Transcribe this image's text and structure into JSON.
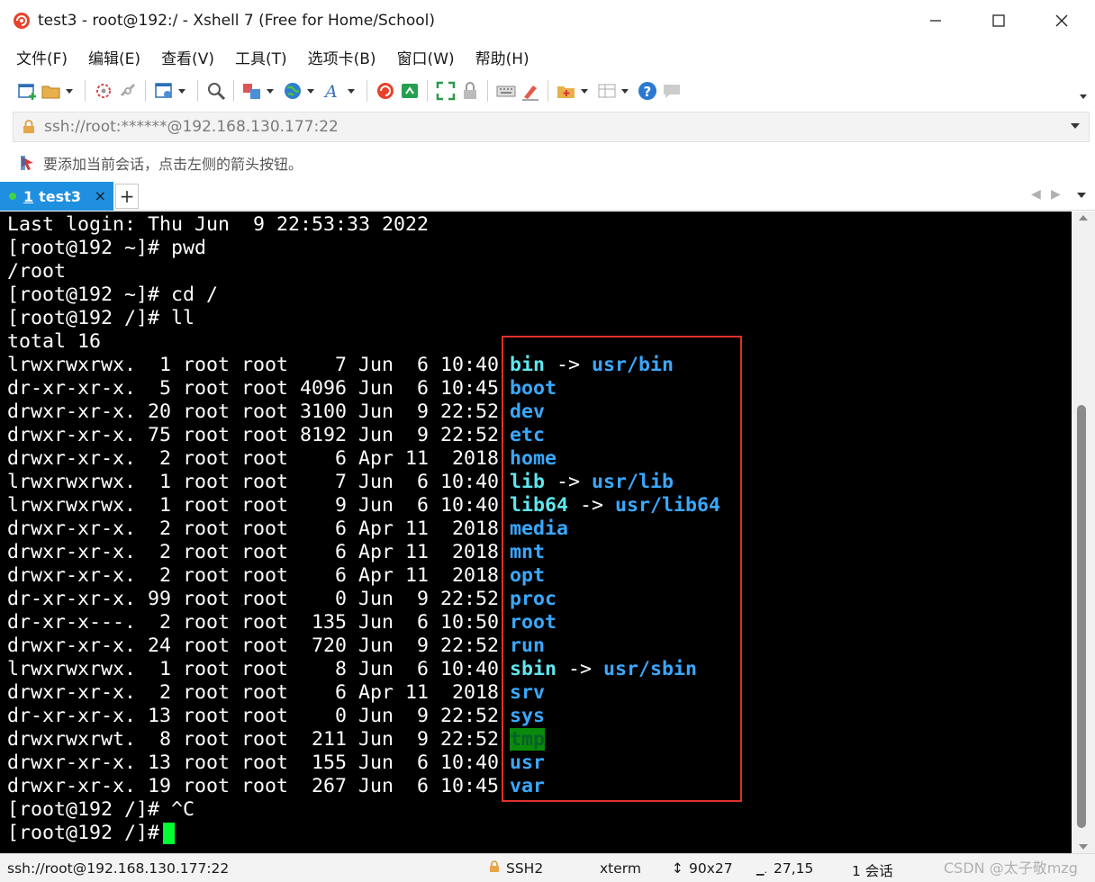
{
  "window": {
    "title": "test3 - root@192:/ - Xshell 7 (Free for Home/School)"
  },
  "menu": [
    "文件(F)",
    "编辑(E)",
    "查看(V)",
    "工具(T)",
    "选项卡(B)",
    "窗口(W)",
    "帮助(H)"
  ],
  "toolbar": {
    "icons": [
      "new-session-icon",
      "open-folder-icon",
      "connect-icon",
      "disconnect-icon",
      "properties-icon",
      "find-icon",
      "transfer-icon",
      "globe-icon",
      "font-icon",
      "xshell-icon",
      "xftp-icon",
      "fullscreen-icon",
      "lock-icon",
      "keyboard-icon",
      "highlight-icon",
      "add-folder-icon",
      "layout-icon",
      "help-icon",
      "chat-icon"
    ]
  },
  "address": {
    "value": "ssh://root:******@192.168.130.177:22"
  },
  "hint": {
    "text": "要添加当前会话，点击左侧的箭头按钮。"
  },
  "tab": {
    "number": "1",
    "label": "test3",
    "close": "×",
    "add": "+"
  },
  "terminal": {
    "header_lines": [
      "Last login: Thu Jun  9 22:53:33 2022",
      "[root@192 ~]# pwd",
      "/root",
      "[root@192 ~]# cd /",
      "[root@192 /]# ll",
      "total 16"
    ],
    "entries": [
      {
        "meta": "lrwxrwxrwx.  1 root root    7 Jun  6 10:40",
        "name": "bin",
        "type": "link",
        "target": "usr/bin"
      },
      {
        "meta": "dr-xr-xr-x.  5 root root 4096 Jun  6 10:45",
        "name": "boot",
        "type": "dir",
        "target": ""
      },
      {
        "meta": "drwxr-xr-x. 20 root root 3100 Jun  9 22:52",
        "name": "dev",
        "type": "dir",
        "target": ""
      },
      {
        "meta": "drwxr-xr-x. 75 root root 8192 Jun  9 22:52",
        "name": "etc",
        "type": "dir",
        "target": ""
      },
      {
        "meta": "drwxr-xr-x.  2 root root    6 Apr 11  2018",
        "name": "home",
        "type": "dir",
        "target": ""
      },
      {
        "meta": "lrwxrwxrwx.  1 root root    7 Jun  6 10:40",
        "name": "lib",
        "type": "link",
        "target": "usr/lib"
      },
      {
        "meta": "lrwxrwxrwx.  1 root root    9 Jun  6 10:40",
        "name": "lib64",
        "type": "link",
        "target": "usr/lib64"
      },
      {
        "meta": "drwxr-xr-x.  2 root root    6 Apr 11  2018",
        "name": "media",
        "type": "dir",
        "target": ""
      },
      {
        "meta": "drwxr-xr-x.  2 root root    6 Apr 11  2018",
        "name": "mnt",
        "type": "dir",
        "target": ""
      },
      {
        "meta": "drwxr-xr-x.  2 root root    6 Apr 11  2018",
        "name": "opt",
        "type": "dir",
        "target": ""
      },
      {
        "meta": "dr-xr-xr-x. 99 root root    0 Jun  9 22:52",
        "name": "proc",
        "type": "dir",
        "target": ""
      },
      {
        "meta": "dr-xr-x---.  2 root root  135 Jun  6 10:50",
        "name": "root",
        "type": "dir",
        "target": ""
      },
      {
        "meta": "drwxr-xr-x. 24 root root  720 Jun  9 22:52",
        "name": "run",
        "type": "dir",
        "target": ""
      },
      {
        "meta": "lrwxrwxrwx.  1 root root    8 Jun  6 10:40",
        "name": "sbin",
        "type": "link",
        "target": "usr/sbin"
      },
      {
        "meta": "drwxr-xr-x.  2 root root    6 Apr 11  2018",
        "name": "srv",
        "type": "dir",
        "target": ""
      },
      {
        "meta": "dr-xr-xr-x. 13 root root    0 Jun  9 22:52",
        "name": "sys",
        "type": "dir",
        "target": ""
      },
      {
        "meta": "drwxrwxrwt.  8 root root  211 Jun  9 22:52",
        "name": "tmp",
        "type": "sticky",
        "target": ""
      },
      {
        "meta": "drwxr-xr-x. 13 root root  155 Jun  6 10:40",
        "name": "usr",
        "type": "dir",
        "target": ""
      },
      {
        "meta": "drwxr-xr-x. 19 root root  267 Jun  6 10:45",
        "name": "var",
        "type": "dir",
        "target": ""
      }
    ],
    "arrow": "->",
    "footer_lines": [
      "[root@192 /]# ^C",
      "[root@192 /]#"
    ],
    "colors": {
      "background": "#000000",
      "text": "#ffffff",
      "dir": "#3aa8ff",
      "link": "#5ee7ee",
      "sticky_bg": "#0a8a0a",
      "cursor": "#00ff33",
      "highlight_box": "#e0302a"
    }
  },
  "status": {
    "connection": "ssh://root@192.168.130.177:22",
    "protocol": "SSH2",
    "terminal_type": "xterm",
    "size": "90x27",
    "cursor_pos": "27,15",
    "sessions": "1 会话",
    "watermark": "CSDN @太子敬mzg"
  }
}
